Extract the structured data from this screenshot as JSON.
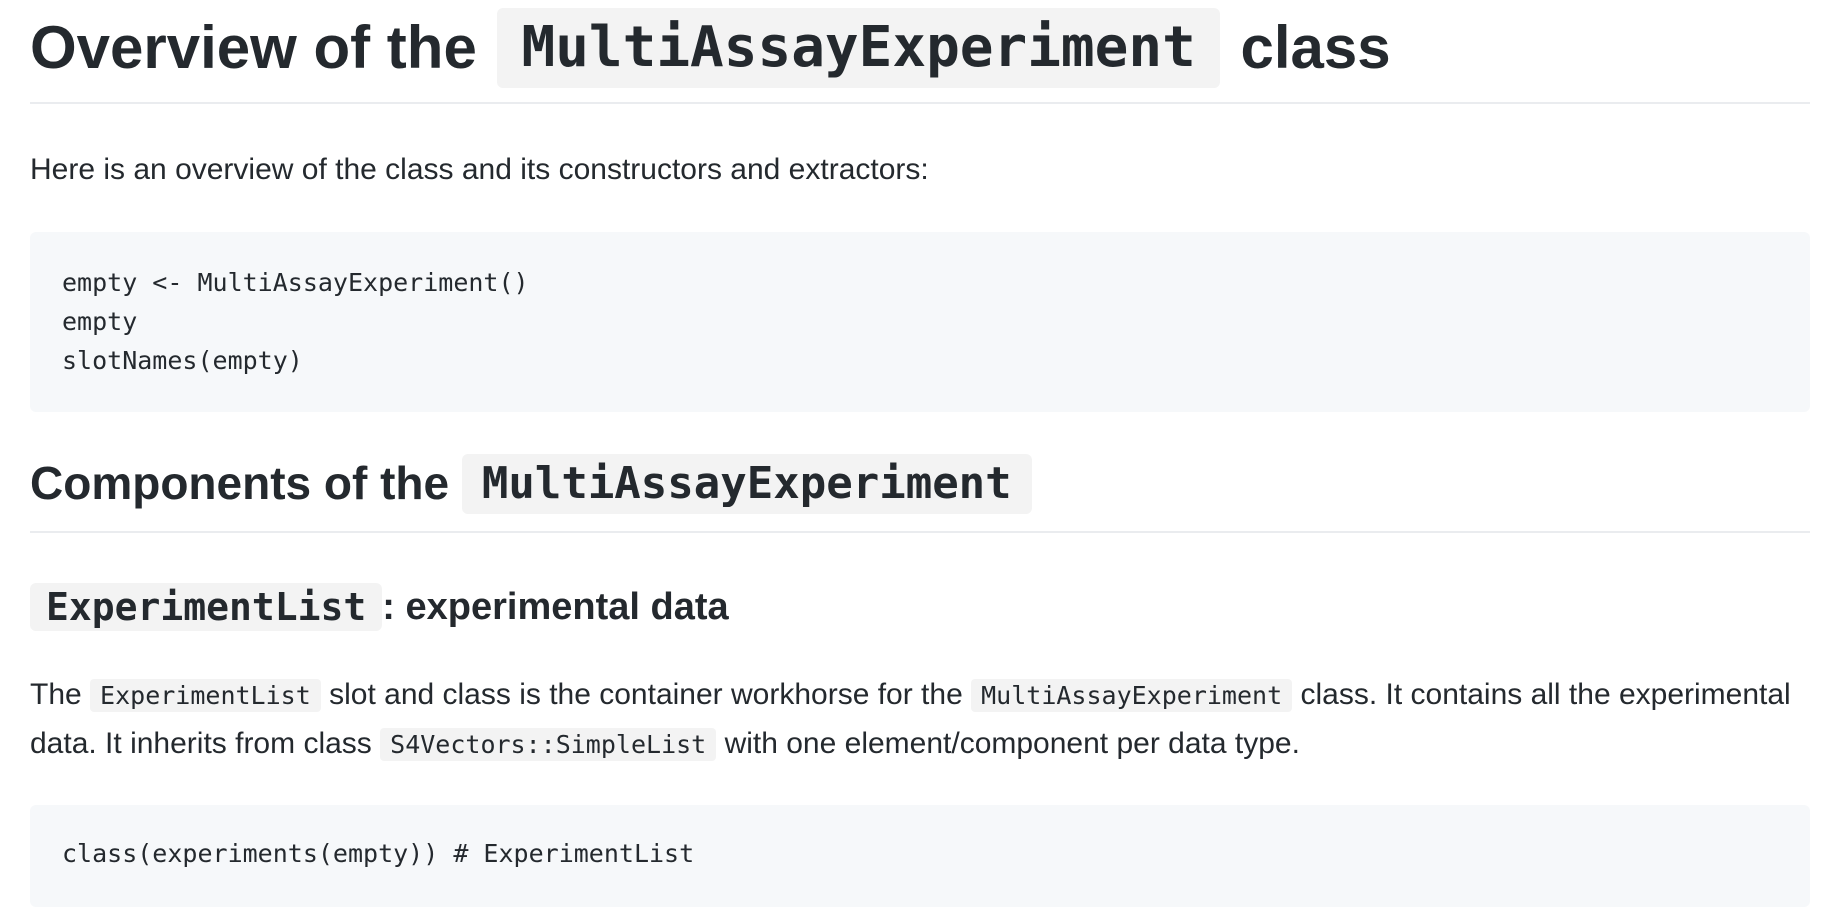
{
  "heading1": {
    "prefix": "Overview of the",
    "code": "MultiAssayExperiment",
    "suffix": "class"
  },
  "intro_text": "Here is an overview of the class and its constructors and extractors:",
  "code_block_1": {
    "lines": [
      "empty <- MultiAssayExperiment()",
      "empty",
      "slotNames(empty)"
    ]
  },
  "heading2": {
    "prefix": "Components of the",
    "code": "MultiAssayExperiment"
  },
  "heading3": {
    "code": "ExperimentList",
    "suffix": ": experimental data"
  },
  "description": {
    "part1": "The",
    "code1": "ExperimentList",
    "part2": "slot and class is the container workhorse for the",
    "code2": "MultiAssayExperiment",
    "part3": "class. It contains all the experimental data. It inherits from class",
    "code3": "S4Vectors::SimpleList",
    "part4": "with one element/component per data type."
  },
  "code_block_2": {
    "lines": [
      "class(experiments(empty)) # ExperimentList"
    ]
  }
}
